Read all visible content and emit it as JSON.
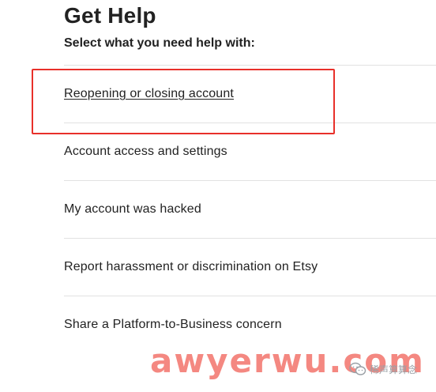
{
  "header": {
    "title": "Get Help",
    "subtitle": "Select what you need help with:"
  },
  "help_options": [
    {
      "label": "Reopening or closing account",
      "highlighted": true
    },
    {
      "label": "Account access and settings"
    },
    {
      "label": "My account was hacked"
    },
    {
      "label": "Report harassment or discrimination on Etsy"
    },
    {
      "label": "Share a Platform-to-Business concern"
    }
  ],
  "colors": {
    "highlight_box": "#e8302a",
    "divider": "#e1e1e1",
    "text": "#222222",
    "watermark": "#f05a50"
  },
  "watermark": {
    "text": "awyerwu.com",
    "wechat_label": "稀声算算念"
  }
}
